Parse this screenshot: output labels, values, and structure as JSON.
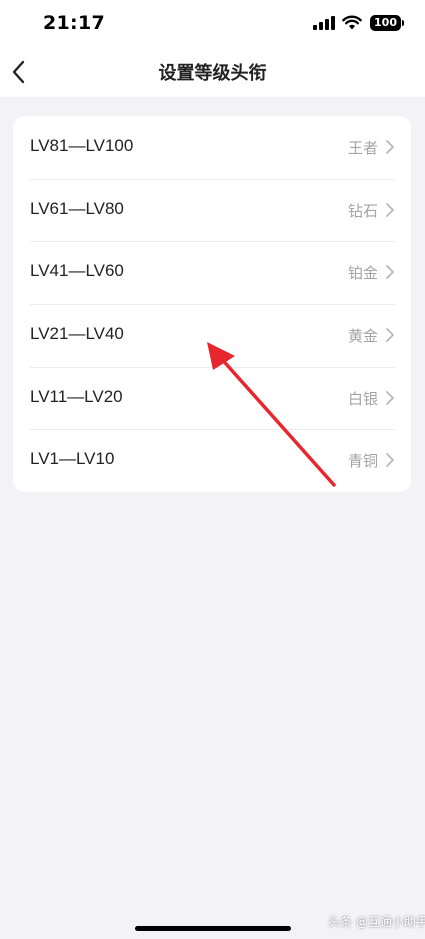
{
  "status_bar": {
    "time": "21:17",
    "battery": "100"
  },
  "nav": {
    "title": "设置等级头衔",
    "back_icon": "chevron-left-icon"
  },
  "levels": [
    {
      "range": "LV81—LV100",
      "title": "王者"
    },
    {
      "range": "LV61—LV80",
      "title": "钻石"
    },
    {
      "range": "LV41—LV60",
      "title": "铂金"
    },
    {
      "range": "LV21—LV40",
      "title": "黄金"
    },
    {
      "range": "LV11—LV20",
      "title": "白银"
    },
    {
      "range": "LV1—LV10",
      "title": "青铜"
    }
  ],
  "watermark": "头条 @互通小助手",
  "colors": {
    "background": "#f2f2f7",
    "card": "#ffffff",
    "secondary_text": "#a3a3a8",
    "annotation_arrow": "#e8262d"
  }
}
